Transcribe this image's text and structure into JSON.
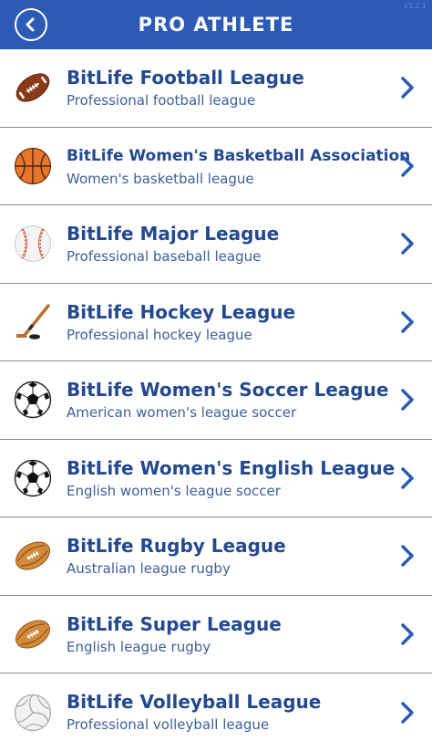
{
  "header": {
    "title": "PRO  ATHLETE",
    "version": "v3.2.1",
    "back_icon": "back-arrow-icon"
  },
  "colors": {
    "header_bg": "#2c5ab4",
    "title_text": "#24498f",
    "subtitle_text": "#3d5f9a",
    "chevron": "#2c5ab4"
  },
  "leagues": [
    {
      "title": "BitLife Football League",
      "subtitle": "Professional football league",
      "icon": "american-football-icon"
    },
    {
      "title": "BitLife Women's Basketball Association",
      "subtitle": "Women's basketball league",
      "icon": "basketball-icon"
    },
    {
      "title": "BitLife Major League",
      "subtitle": "Professional baseball league",
      "icon": "baseball-icon"
    },
    {
      "title": "BitLife Hockey League",
      "subtitle": "Professional hockey league",
      "icon": "hockey-stick-icon"
    },
    {
      "title": "BitLife Women's Soccer League",
      "subtitle": "American women's league soccer",
      "icon": "soccer-ball-icon"
    },
    {
      "title": "BitLife Women's English League",
      "subtitle": "English women's league soccer",
      "icon": "soccer-ball-icon"
    },
    {
      "title": "BitLife Rugby League",
      "subtitle": "Australian league rugby",
      "icon": "rugby-ball-icon"
    },
    {
      "title": "BitLife Super League",
      "subtitle": "English league rugby",
      "icon": "rugby-ball-icon"
    },
    {
      "title": "BitLife Volleyball League",
      "subtitle": "Professional volleyball league",
      "icon": "volleyball-icon"
    }
  ]
}
